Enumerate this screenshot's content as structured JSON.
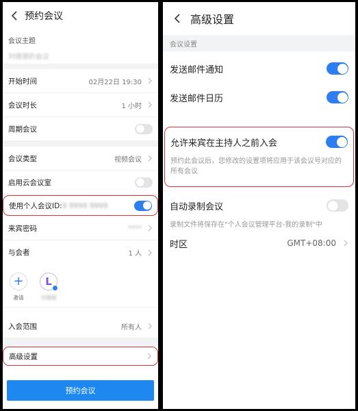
{
  "left": {
    "title": "预约会议",
    "subject": {
      "label": "会议主题",
      "placeholder": "刘德德的会议"
    },
    "rows": {
      "start_time": {
        "label": "开始时间",
        "value": "02月22日 19:30"
      },
      "duration": {
        "label": "会议时长",
        "value": "1 小时"
      },
      "recurring": {
        "label": "周期会议",
        "on": false
      },
      "meeting_type": {
        "label": "会议类型",
        "value": "视频会议"
      },
      "cloud_room": {
        "label": "启用云会议室",
        "on": false
      },
      "personal_id": {
        "label": "使用个人会议ID:",
        "value": "9 9999 9999",
        "on": true
      },
      "guest_password": {
        "label": "来宾密码",
        "value": "****"
      },
      "participants": {
        "label": "与会者",
        "value": "1 人"
      },
      "join_scope": {
        "label": "入会范围",
        "value": "所有人"
      },
      "advanced": {
        "label": "高级设置"
      }
    },
    "attendees": {
      "invite_label": "邀请",
      "avatar_letter": "L",
      "avatar_name": "刘德德"
    },
    "submit_label": "预约会议"
  },
  "right": {
    "title": "高级设置",
    "section_label": "会议设置",
    "rows": {
      "email_notify": {
        "label": "发送邮件通知",
        "on": true
      },
      "email_calendar": {
        "label": "发送邮件日历",
        "on": true
      },
      "join_before_host": {
        "label": "允许来宾在主持人之前入会",
        "on": true,
        "desc": "预约此会议后，您修改的设置项将应用于该会议号对应的所有会议"
      },
      "auto_record": {
        "label": "自动录制会议",
        "on": false,
        "desc": "录制文件将保存在\"个人会议管理平台-我的录制\"中"
      },
      "timezone": {
        "label": "时区",
        "value": "GMT+08:00"
      }
    }
  },
  "colors": {
    "accent": "#2e7ef2",
    "highlight": "#d7313a"
  }
}
